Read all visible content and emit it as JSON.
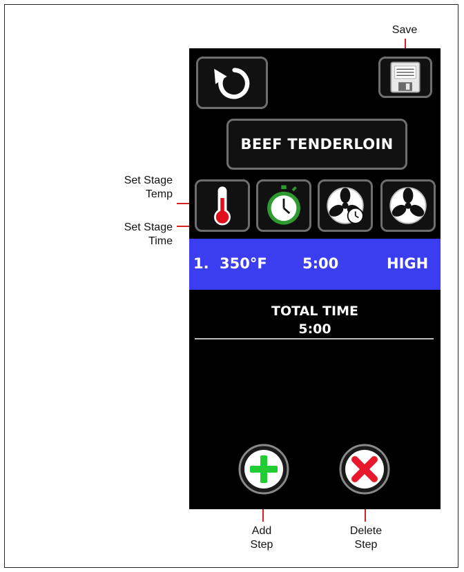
{
  "recipe": {
    "title": "BEEF TENDERLOIN"
  },
  "stage": {
    "number": "1.",
    "temp": "350°F",
    "time": "5:00",
    "fan": "HIGH"
  },
  "total": {
    "label": "TOTAL TIME",
    "value": "5:00"
  },
  "callouts": {
    "save": "Save",
    "set_temp_line1": "Set Stage",
    "set_temp_line2": "Temp",
    "set_time_line1": "Set Stage",
    "set_time_line2": "Time",
    "add_line1": "Add",
    "add_line2": "Step",
    "delete_line1": "Delete",
    "delete_line2": "Step"
  },
  "icons": {
    "back": "undo-arrow-icon",
    "save": "floppy-disk-icon",
    "temp": "thermometer-icon",
    "time": "stopwatch-icon",
    "fan_timer": "fan-timer-icon",
    "fan": "fan-icon",
    "add": "plus-icon",
    "delete": "x-icon"
  },
  "colors": {
    "screen_bg": "#000000",
    "stage_row": "#3a3ef0",
    "button_border": "#6e6e6e",
    "callout_line": "#d42020",
    "add_green": "#22cc33",
    "delete_red": "#e8192c",
    "thermo_red": "#e0101a"
  }
}
